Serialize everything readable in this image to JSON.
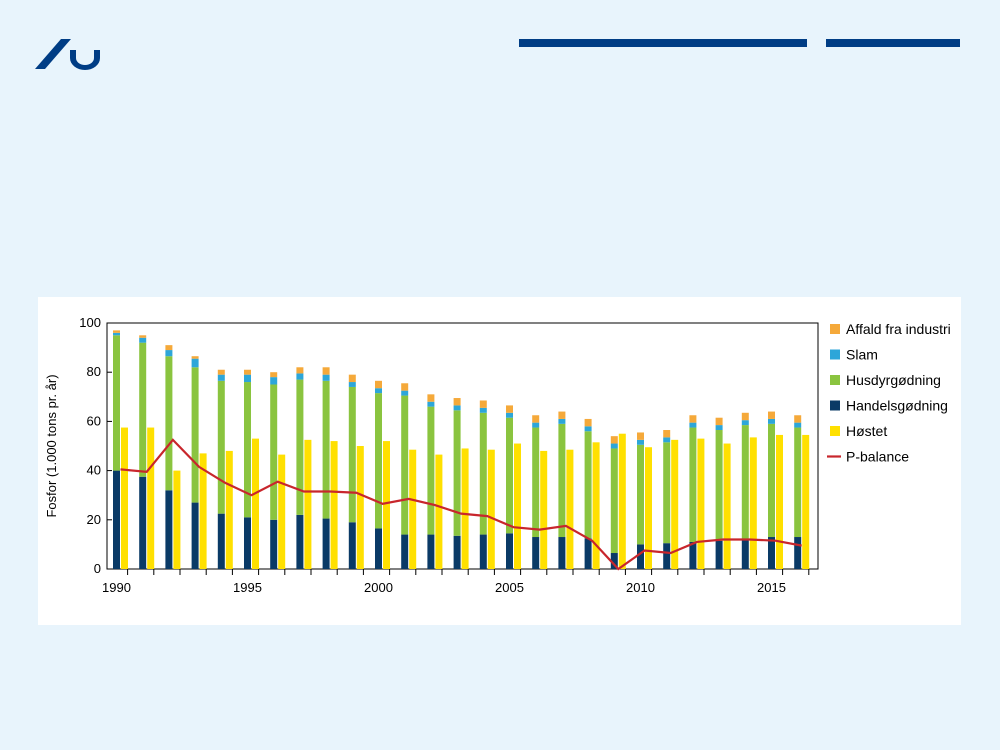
{
  "branding": {
    "logo_icon": "au-logo-icon",
    "colors": {
      "brand": "#003d85",
      "background": "#e8f4fc"
    }
  },
  "chart_data": {
    "type": "bar",
    "ylabel": "Fosfor (1.000 tons pr. år)",
    "xlabel": "",
    "ylim": [
      0,
      100
    ],
    "yticks": [
      0,
      20,
      40,
      60,
      80,
      100
    ],
    "xticks": [
      "1990",
      "1995",
      "2000",
      "2005",
      "2010",
      "2015"
    ],
    "legend_position": "right",
    "grid": false,
    "categories": [
      1990,
      1991,
      1992,
      1993,
      1994,
      1995,
      1996,
      1997,
      1998,
      1999,
      2000,
      2001,
      2002,
      2003,
      2004,
      2005,
      2006,
      2007,
      2008,
      2009,
      2010,
      2011,
      2012,
      2013,
      2014,
      2015,
      2016
    ],
    "legend": [
      "Affald fra industri",
      "Slam",
      "Husdyrgødning",
      "Handelsgødning",
      "Høstet",
      "P-balance"
    ],
    "stacked_series": [
      {
        "name": "Handelsgødning",
        "color": "#0a3a66",
        "values": [
          40,
          37.5,
          32,
          27,
          22.5,
          21,
          20,
          22,
          20.5,
          19,
          16.5,
          14,
          14,
          13.5,
          14,
          14.5,
          13,
          13,
          12.5,
          6.5,
          10,
          10.5,
          11,
          11.5,
          12,
          13,
          13
        ]
      },
      {
        "name": "Husdyrgødning",
        "color": "#8ac43f",
        "values": [
          55,
          54.5,
          54.5,
          55,
          54,
          55,
          55,
          55,
          56,
          55,
          55,
          56.5,
          52,
          51,
          49.5,
          47,
          44.5,
          46,
          43.5,
          42.5,
          40.5,
          41,
          46.5,
          45,
          46.5,
          46,
          44.5
        ]
      },
      {
        "name": "Slam",
        "color": "#2da6d9",
        "values": [
          1,
          2,
          2.5,
          3.5,
          2.5,
          3,
          3,
          2.5,
          2.5,
          2,
          2,
          2,
          2,
          2,
          2,
          2,
          2,
          2,
          2,
          2,
          2,
          2,
          2,
          2,
          2,
          2,
          2
        ]
      },
      {
        "name": "Affald fra industri",
        "color": "#f5a93a",
        "values": [
          1,
          1,
          2,
          1,
          2,
          2,
          2,
          2.5,
          3,
          3,
          3,
          3,
          3,
          3,
          3,
          3,
          3,
          3,
          3,
          3,
          3,
          3,
          3,
          3,
          3,
          3,
          3
        ]
      }
    ],
    "harvested_series": {
      "name": "Høstet",
      "color": "#ffe000",
      "values": [
        57.5,
        57.5,
        40,
        47,
        48,
        53,
        46.5,
        52.5,
        52,
        50,
        52,
        48.5,
        46.5,
        49,
        48.5,
        51,
        48,
        48.5,
        51.5,
        55,
        49.5,
        52.5,
        53,
        51,
        53.5,
        54.5,
        54.5
      ]
    },
    "line_series": {
      "name": "P-balance",
      "color": "#c8262c",
      "values": [
        40.5,
        39.5,
        52.5,
        41.5,
        35,
        30,
        35.5,
        31.5,
        31.5,
        31,
        26.5,
        28.5,
        26,
        22.5,
        21.5,
        17,
        16,
        17.5,
        11.5,
        0,
        7.5,
        6.5,
        11,
        12,
        12,
        11.5,
        9.5
      ]
    }
  }
}
